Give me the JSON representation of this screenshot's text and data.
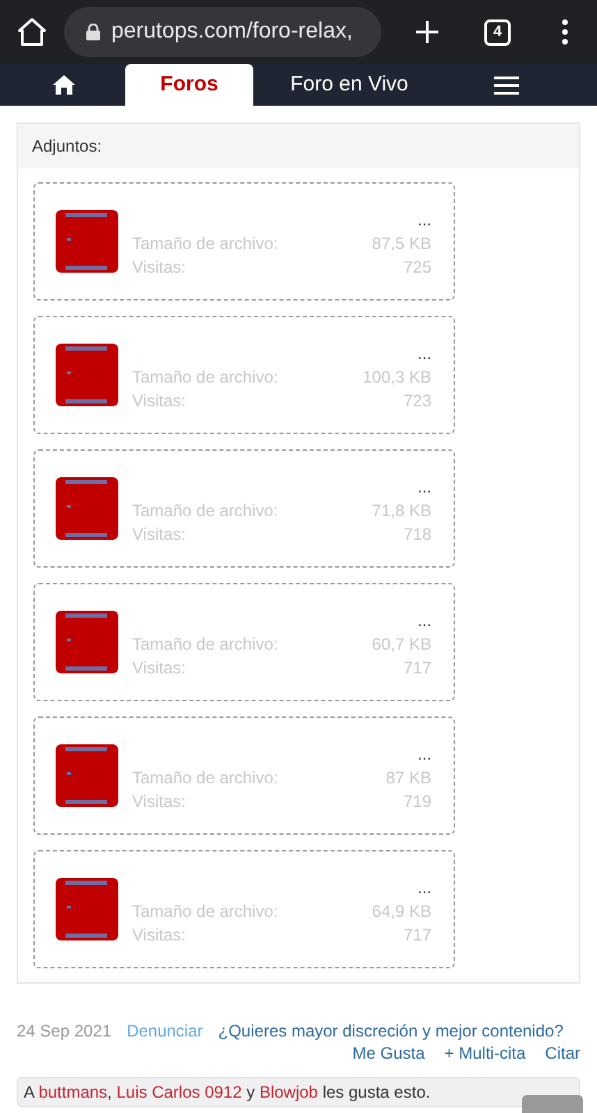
{
  "browser": {
    "url": "perutops.com/foro-relax,",
    "tab_count": "4"
  },
  "nav": {
    "tabs": [
      {
        "kind": "home",
        "selected": false
      },
      {
        "kind": "text",
        "label": "Foros",
        "selected": true
      },
      {
        "kind": "text",
        "label": "Foro en Vivo",
        "selected": false
      },
      {
        "kind": "menu",
        "selected": false
      }
    ]
  },
  "attachments": {
    "title": "Adjuntos:",
    "items": [
      {
        "name": "...",
        "size_label": "Tamaño de archivo:",
        "size": "87,5 KB",
        "views_label": "Visitas:",
        "views": "725"
      },
      {
        "name": "...",
        "size_label": "Tamaño de archivo:",
        "size": "100,3 KB",
        "views_label": "Visitas:",
        "views": "723"
      },
      {
        "name": "...",
        "size_label": "Tamaño de archivo:",
        "size": "71,8 KB",
        "views_label": "Visitas:",
        "views": "718"
      },
      {
        "name": "...",
        "size_label": "Tamaño de archivo:",
        "size": "60,7 KB",
        "views_label": "Visitas:",
        "views": "717"
      },
      {
        "name": "...",
        "size_label": "Tamaño de archivo:",
        "size": "87 KB",
        "views_label": "Visitas:",
        "views": "719"
      },
      {
        "name": "...",
        "size_label": "Tamaño de archivo:",
        "size": "64,9 KB",
        "views_label": "Visitas:",
        "views": "717"
      }
    ]
  },
  "post_footer": {
    "date": "24 Sep 2021",
    "report": "Denunciar",
    "promo": "¿Quieres mayor discreción y mejor contenido?",
    "actions": [
      "Me Gusta",
      "+ Multi-cita",
      "Citar"
    ]
  },
  "likes": [
    {
      "kind": "text",
      "text": "A "
    },
    {
      "kind": "link",
      "text": "buttmans"
    },
    {
      "kind": "text",
      "text": ", "
    },
    {
      "kind": "link",
      "text": "Luis Carlos 0912"
    },
    {
      "kind": "text",
      "text": " y "
    },
    {
      "kind": "link",
      "text": "Blowjob"
    },
    {
      "kind": "text",
      "text": " les gusta esto."
    }
  ]
}
